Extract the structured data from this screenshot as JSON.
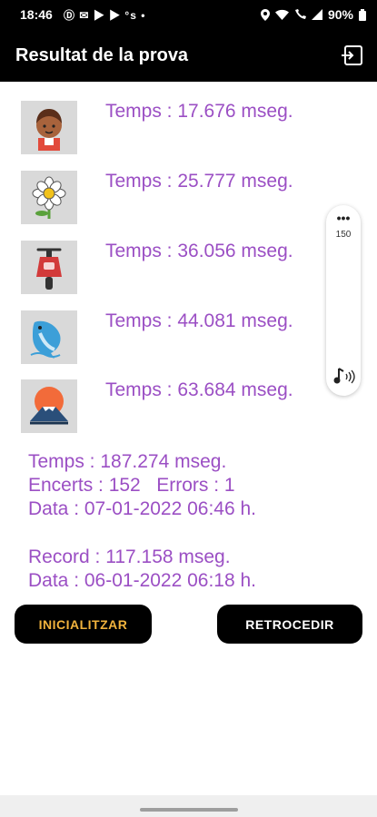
{
  "status_bar": {
    "time": "18:46",
    "icons_left": [
      "status-d-icon",
      "message-icon",
      "youtube-icon",
      "youtube-icon",
      "temp-icon",
      "dot-icon"
    ],
    "icons_left_text": "Ⓓ ✉ ▶ ▶ °s •",
    "battery": "90%"
  },
  "app_bar": {
    "title": "Resultat de la prova"
  },
  "results": [
    {
      "icon": "boy-face-icon",
      "time_text": "Temps : 17.676 mseg."
    },
    {
      "icon": "daisy-flower-icon",
      "time_text": "Temps : 25.777 mseg."
    },
    {
      "icon": "scooter-icon",
      "time_text": "Temps : 36.056 mseg."
    },
    {
      "icon": "dolphin-icon",
      "time_text": "Temps : 44.081 mseg."
    },
    {
      "icon": "mount-fuji-icon",
      "time_text": "Temps : 63.684 mseg."
    }
  ],
  "summary": {
    "total_time": "Temps : 187.274 mseg.",
    "hits_errors": "Encerts : 152   Errors : 1",
    "date": "Data : 07-01-2022 06:46 h.",
    "record": "Record : 117.158 mseg.",
    "record_date": "Data : 06-01-2022 06:18 h."
  },
  "buttons": {
    "init_label": "INICIALITZAR",
    "back_label": "RETROCEDIR"
  },
  "floating_panel": {
    "count": "150",
    "more_icon": "more-horizontal-icon",
    "sound_icon": "music-note-sound-icon"
  },
  "colors": {
    "accent_text": "#9b4fc4",
    "init_button_text": "#f2b33d",
    "bars": "#000000"
  }
}
